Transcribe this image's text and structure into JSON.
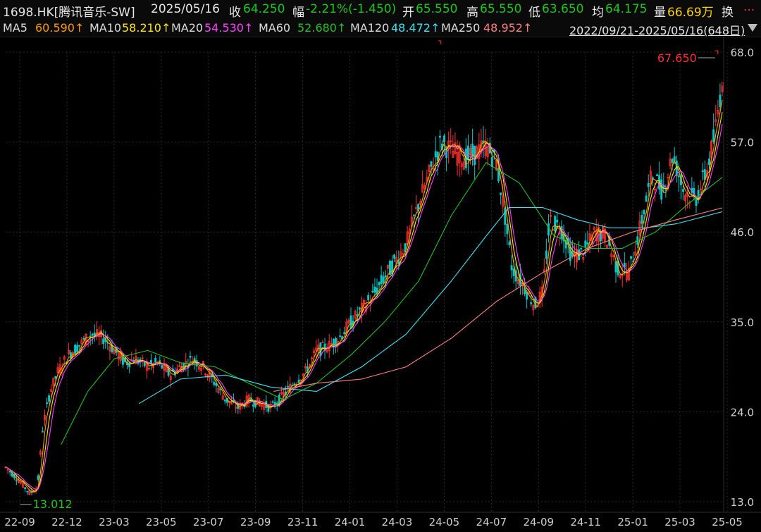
{
  "header": {
    "symbol": "1698.HK[腾讯音乐-SW]",
    "date": "2025/05/16",
    "close_label": "收",
    "close_value": "64.250",
    "change_label": "幅",
    "change_value": "-2.21%(-1.450)",
    "open_label": "开",
    "open_value": "65.550",
    "high_label": "高",
    "high_value": "65.550",
    "low_label": "低",
    "low_value": "63.650",
    "avg_label": "均",
    "avg_value": "64.175",
    "vol_label": "量",
    "vol_value": "66.69万",
    "turnover_label": "换",
    "more": "..."
  },
  "ma_line": {
    "items": [
      {
        "label": "MA5",
        "value": "60.590↑",
        "color": "#ff9a00"
      },
      {
        "label": "MA10",
        "value": "58.210↑",
        "color": "#ffe800"
      },
      {
        "label": "MA20",
        "value": "54.530↑",
        "color": "#ff40ff"
      },
      {
        "label": "MA60",
        "value": "52.680↑",
        "color": "#22c022"
      },
      {
        "label": "MA120",
        "value": "48.472↑",
        "color": "#40e0f0"
      },
      {
        "label": "MA250",
        "value": "48.952↑",
        "color": "#ff8080"
      }
    ],
    "range": "2022/09/21-2025/05/16(648日)",
    "dropdown_icon": "triangle-down-icon"
  },
  "colors": {
    "up": "#ff3030",
    "down": "#00c8c8",
    "ma5": "#ff9a00",
    "ma10": "#ffe800",
    "ma20": "#ff40ff",
    "ma60": "#22c022",
    "ma120": "#40e0f0",
    "ma250": "#ff8080",
    "grid": "#2a2a2a"
  },
  "chart_data": {
    "type": "line",
    "title": "",
    "ylim": [
      13.0,
      68.0
    ],
    "y_ticks": [
      "68.0",
      "57.0",
      "46.0",
      "35.0",
      "24.0",
      "13.0"
    ],
    "x_ticks": [
      "22-09",
      "22-12",
      "23-03",
      "23-05",
      "23-07",
      "23-09",
      "23-11",
      "24-01",
      "24-03",
      "24-05",
      "24-07",
      "24-09",
      "24-11",
      "25-01",
      "25-03",
      "25-05"
    ],
    "x_domain": [
      "2022-09-21",
      "2025-05-16"
    ],
    "annotations": [
      {
        "text": "67.650",
        "kind": "high",
        "date": "2025-05-12",
        "value": 67.65
      },
      {
        "text": "13.012",
        "kind": "low",
        "date": "2022-10-24",
        "value": 13.012
      }
    ],
    "close_series": {
      "name": "",
      "points": [
        [
          "2022-09-21",
          17.2
        ],
        [
          "2022-10-05",
          16.0
        ],
        [
          "2022-10-24",
          14.0
        ],
        [
          "2022-11-03",
          14.8
        ],
        [
          "2022-11-10",
          22.0
        ],
        [
          "2022-11-20",
          26.5
        ],
        [
          "2022-12-01",
          29.0
        ],
        [
          "2022-12-15",
          31.0
        ],
        [
          "2023-01-03",
          32.5
        ],
        [
          "2023-01-15",
          33.5
        ],
        [
          "2023-02-01",
          33.0
        ],
        [
          "2023-02-15",
          31.5
        ],
        [
          "2023-03-01",
          30.0
        ],
        [
          "2023-03-15",
          30.5
        ],
        [
          "2023-04-01",
          29.5
        ],
        [
          "2023-04-15",
          30.0
        ],
        [
          "2023-05-01",
          28.5
        ],
        [
          "2023-05-15",
          29.5
        ],
        [
          "2023-06-01",
          30.5
        ],
        [
          "2023-06-15",
          29.5
        ],
        [
          "2023-07-01",
          27.5
        ],
        [
          "2023-07-15",
          25.5
        ],
        [
          "2023-08-01",
          24.5
        ],
        [
          "2023-08-15",
          25.5
        ],
        [
          "2023-09-01",
          25.0
        ],
        [
          "2023-09-15",
          24.5
        ],
        [
          "2023-10-01",
          26.0
        ],
        [
          "2023-10-15",
          27.5
        ],
        [
          "2023-11-01",
          29.0
        ],
        [
          "2023-11-15",
          31.5
        ],
        [
          "2023-12-01",
          32.0
        ],
        [
          "2023-12-15",
          33.0
        ],
        [
          "2024-01-01",
          35.0
        ],
        [
          "2024-01-15",
          36.5
        ],
        [
          "2024-02-01",
          38.5
        ],
        [
          "2024-02-15",
          40.5
        ],
        [
          "2024-03-01",
          42.5
        ],
        [
          "2024-03-15",
          44.5
        ],
        [
          "2024-04-01",
          49.5
        ],
        [
          "2024-04-15",
          53.0
        ],
        [
          "2024-05-01",
          57.0
        ],
        [
          "2024-05-15",
          56.0
        ],
        [
          "2024-06-01",
          55.0
        ],
        [
          "2024-06-15",
          55.5
        ],
        [
          "2024-07-01",
          56.5
        ],
        [
          "2024-07-15",
          54.5
        ],
        [
          "2024-07-25",
          49.0
        ],
        [
          "2024-08-05",
          41.5
        ],
        [
          "2024-08-20",
          39.5
        ],
        [
          "2024-09-05",
          37.0
        ],
        [
          "2024-09-15",
          38.5
        ],
        [
          "2024-09-25",
          47.5
        ],
        [
          "2024-10-10",
          46.5
        ],
        [
          "2024-10-25",
          43.0
        ],
        [
          "2024-11-10",
          43.5
        ],
        [
          "2024-11-25",
          46.0
        ],
        [
          "2024-12-10",
          45.5
        ],
        [
          "2024-12-25",
          41.5
        ],
        [
          "2025-01-10",
          41.0
        ],
        [
          "2025-01-25",
          46.5
        ],
        [
          "2025-02-10",
          53.0
        ],
        [
          "2025-02-25",
          51.0
        ],
        [
          "2025-03-10",
          55.5
        ],
        [
          "2025-03-25",
          51.0
        ],
        [
          "2025-04-10",
          50.0
        ],
        [
          "2025-04-25",
          53.5
        ],
        [
          "2025-05-05",
          57.5
        ],
        [
          "2025-05-12",
          62.0
        ],
        [
          "2025-05-16",
          64.25
        ]
      ]
    },
    "series": [
      {
        "name": "MA5",
        "key": "ma5",
        "smooth": 1
      },
      {
        "name": "MA10",
        "key": "ma10",
        "smooth": 2
      },
      {
        "name": "MA20",
        "key": "ma20",
        "smooth": 3
      },
      {
        "name": "MA60",
        "key": "ma60",
        "points": [
          [
            "2022-12-05",
            20.0
          ],
          [
            "2023-01-10",
            26.5
          ],
          [
            "2023-02-15",
            30.5
          ],
          [
            "2023-04-01",
            31.5
          ],
          [
            "2023-05-15",
            30.0
          ],
          [
            "2023-07-01",
            29.5
          ],
          [
            "2023-08-15",
            27.5
          ],
          [
            "2023-10-01",
            25.5
          ],
          [
            "2023-11-15",
            27.5
          ],
          [
            "2024-01-01",
            31.0
          ],
          [
            "2024-02-15",
            35.0
          ],
          [
            "2024-04-01",
            40.0
          ],
          [
            "2024-05-15",
            48.0
          ],
          [
            "2024-07-01",
            54.5
          ],
          [
            "2024-08-15",
            52.0
          ],
          [
            "2024-10-01",
            45.5
          ],
          [
            "2024-11-15",
            44.0
          ],
          [
            "2025-01-01",
            44.0
          ],
          [
            "2025-02-15",
            46.0
          ],
          [
            "2025-04-01",
            49.5
          ],
          [
            "2025-05-16",
            52.68
          ]
        ]
      },
      {
        "name": "MA120",
        "key": "ma120",
        "points": [
          [
            "2023-03-20",
            25.0
          ],
          [
            "2023-05-15",
            28.0
          ],
          [
            "2023-07-15",
            28.5
          ],
          [
            "2023-09-15",
            27.0
          ],
          [
            "2023-11-15",
            26.5
          ],
          [
            "2024-01-15",
            29.5
          ],
          [
            "2024-03-15",
            33.5
          ],
          [
            "2024-05-15",
            40.0
          ],
          [
            "2024-07-01",
            45.5
          ],
          [
            "2024-08-01",
            49.0
          ],
          [
            "2024-09-15",
            49.0
          ],
          [
            "2024-11-01",
            47.5
          ],
          [
            "2024-12-15",
            46.5
          ],
          [
            "2025-02-01",
            46.5
          ],
          [
            "2025-03-15",
            47.0
          ],
          [
            "2025-05-16",
            48.47
          ]
        ]
      },
      {
        "name": "MA250",
        "key": "ma250",
        "points": [
          [
            "2023-09-18",
            26.5
          ],
          [
            "2023-11-15",
            27.5
          ],
          [
            "2024-01-15",
            28.0
          ],
          [
            "2024-03-15",
            29.5
          ],
          [
            "2024-05-15",
            33.0
          ],
          [
            "2024-07-15",
            37.5
          ],
          [
            "2024-09-15",
            41.0
          ],
          [
            "2024-11-15",
            44.0
          ],
          [
            "2025-01-15",
            46.0
          ],
          [
            "2025-03-15",
            47.5
          ],
          [
            "2025-05-16",
            48.95
          ]
        ]
      }
    ]
  }
}
